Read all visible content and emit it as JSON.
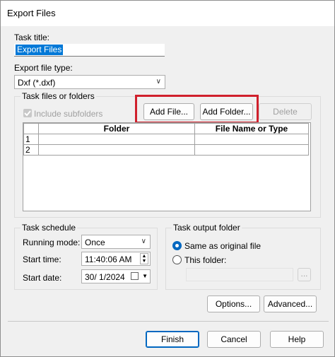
{
  "window": {
    "title": "Export Files"
  },
  "task_title": {
    "label": "Task title:",
    "value": "Export Files"
  },
  "export_type": {
    "label": "Export file type:",
    "value": "Dxf (*.dxf)"
  },
  "files_group": {
    "title": "Task files or folders",
    "include_subfolders": "Include subfolders",
    "add_file": "Add File...",
    "add_folder": "Add Folder...",
    "delete": "Delete",
    "columns": [
      "Folder",
      "File Name or Type"
    ],
    "rows": [
      "1",
      "2"
    ]
  },
  "schedule": {
    "title": "Task schedule",
    "running_mode_label": "Running mode:",
    "running_mode_value": "Once",
    "start_time_label": "Start time:",
    "start_time_value": "11:40:06 AM",
    "start_date_label": "Start date:",
    "start_date_value": "30/  1/2024"
  },
  "output": {
    "title": "Task output folder",
    "same_as_original": "Same as original file",
    "this_folder": "This folder:",
    "browse": "..."
  },
  "buttons": {
    "options": "Options...",
    "advanced": "Advanced...",
    "finish": "Finish",
    "cancel": "Cancel",
    "help": "Help"
  },
  "colors": {
    "accent": "#0067c0",
    "highlight": "#d0202c"
  }
}
